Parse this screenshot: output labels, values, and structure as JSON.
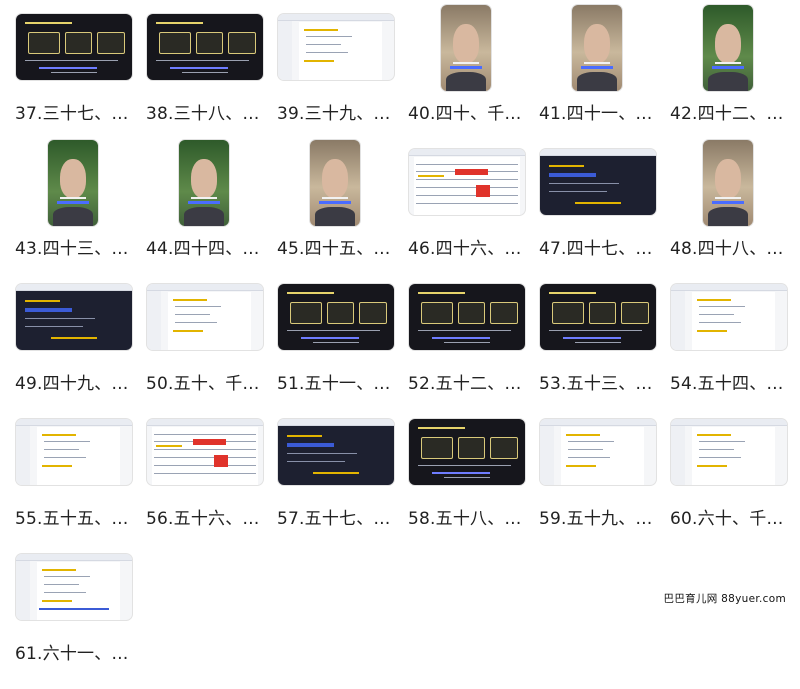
{
  "items": [
    {
      "caption": "37.三十七、…",
      "thumb_style": "dark",
      "shape": "landscape"
    },
    {
      "caption": "38.三十八、…",
      "thumb_style": "dark",
      "shape": "landscape"
    },
    {
      "caption": "39.三十九、…",
      "thumb_style": "document",
      "shape": "landscape"
    },
    {
      "caption": "40.四十、千…",
      "thumb_style": "video",
      "shape": "portrait"
    },
    {
      "caption": "41.四十一、…",
      "thumb_style": "video",
      "shape": "portrait"
    },
    {
      "caption": "42.四十二、…",
      "thumb_style": "video-green",
      "shape": "portrait"
    },
    {
      "caption": "43.四十三、…",
      "thumb_style": "video-green",
      "shape": "portrait"
    },
    {
      "caption": "44.四十四、…",
      "thumb_style": "video-green",
      "shape": "portrait"
    },
    {
      "caption": "45.四十五、…",
      "thumb_style": "video",
      "shape": "portrait"
    },
    {
      "caption": "46.四十六、…",
      "thumb_style": "spreadsheet",
      "shape": "landscape"
    },
    {
      "caption": "47.四十七、…",
      "thumb_style": "screen-dark",
      "shape": "landscape"
    },
    {
      "caption": "48.四十八、…",
      "thumb_style": "video",
      "shape": "portrait"
    },
    {
      "caption": "49.四十九、…",
      "thumb_style": "screen-dark",
      "shape": "landscape"
    },
    {
      "caption": "50.五十、千…",
      "thumb_style": "document",
      "shape": "landscape"
    },
    {
      "caption": "51.五十一、…",
      "thumb_style": "dark",
      "shape": "landscape"
    },
    {
      "caption": "52.五十二、…",
      "thumb_style": "dark",
      "shape": "landscape"
    },
    {
      "caption": "53.五十三、…",
      "thumb_style": "dark",
      "shape": "landscape"
    },
    {
      "caption": "54.五十四、…",
      "thumb_style": "document",
      "shape": "landscape"
    },
    {
      "caption": "55.五十五、…",
      "thumb_style": "document",
      "shape": "landscape"
    },
    {
      "caption": "56.五十六、…",
      "thumb_style": "spreadsheet",
      "shape": "landscape"
    },
    {
      "caption": "57.五十七、…",
      "thumb_style": "screen-dark",
      "shape": "landscape"
    },
    {
      "caption": "58.五十八、…",
      "thumb_style": "dark",
      "shape": "landscape"
    },
    {
      "caption": "59.五十九、…",
      "thumb_style": "document",
      "shape": "landscape"
    },
    {
      "caption": "60.六十、千…",
      "thumb_style": "document",
      "shape": "landscape"
    },
    {
      "caption": "61.六十一、…",
      "thumb_style": "app",
      "shape": "landscape"
    }
  ],
  "watermark": "巴巴育儿网 88yuer.com",
  "colors": {
    "caption_text": "#222222",
    "dark_bg": "#16161c",
    "highlight_yellow": "#e6d36b",
    "accent_blue": "#6f7dff",
    "sheet_red": "#e0332b"
  }
}
